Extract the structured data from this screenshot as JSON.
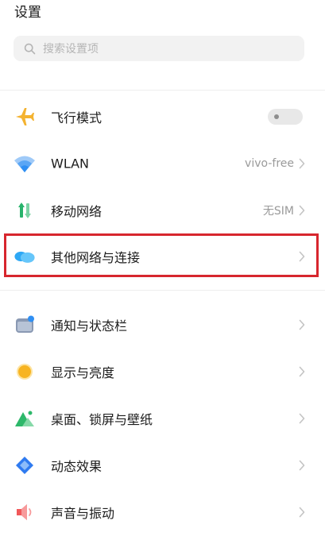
{
  "header": {
    "title": "设置"
  },
  "search": {
    "placeholder": "搜索设置项"
  },
  "section1": [
    {
      "id": "airplane",
      "label": "飞行模式",
      "icon": "airplane-icon",
      "toggle": "off"
    },
    {
      "id": "wlan",
      "label": "WLAN",
      "value": "vivo-free",
      "icon": "wifi-icon"
    },
    {
      "id": "mobile",
      "label": "移动网络",
      "value": "无SIM",
      "icon": "mobile-data-icon"
    },
    {
      "id": "other",
      "label": "其他网络与连接",
      "icon": "cloud-link-icon",
      "highlighted": true
    }
  ],
  "section2": [
    {
      "id": "notification",
      "label": "通知与状态栏",
      "icon": "notification-icon"
    },
    {
      "id": "display",
      "label": "显示与亮度",
      "icon": "brightness-icon"
    },
    {
      "id": "wallpaper",
      "label": "桌面、锁屏与壁纸",
      "icon": "wallpaper-icon"
    },
    {
      "id": "effects",
      "label": "动态效果",
      "icon": "effects-icon"
    },
    {
      "id": "sound",
      "label": "声音与振动",
      "icon": "speaker-icon"
    }
  ],
  "colors": {
    "highlight_border": "#d7262e",
    "airplane": "#f4b331",
    "wifi": "#2f8ff3",
    "mobile_green": "#27b36b",
    "cloud": "#2ea8f5",
    "brightness": "#f7b422",
    "wallpaper": "#2db86a",
    "effects": "#2f7bf0",
    "sound": "#f1585a"
  }
}
